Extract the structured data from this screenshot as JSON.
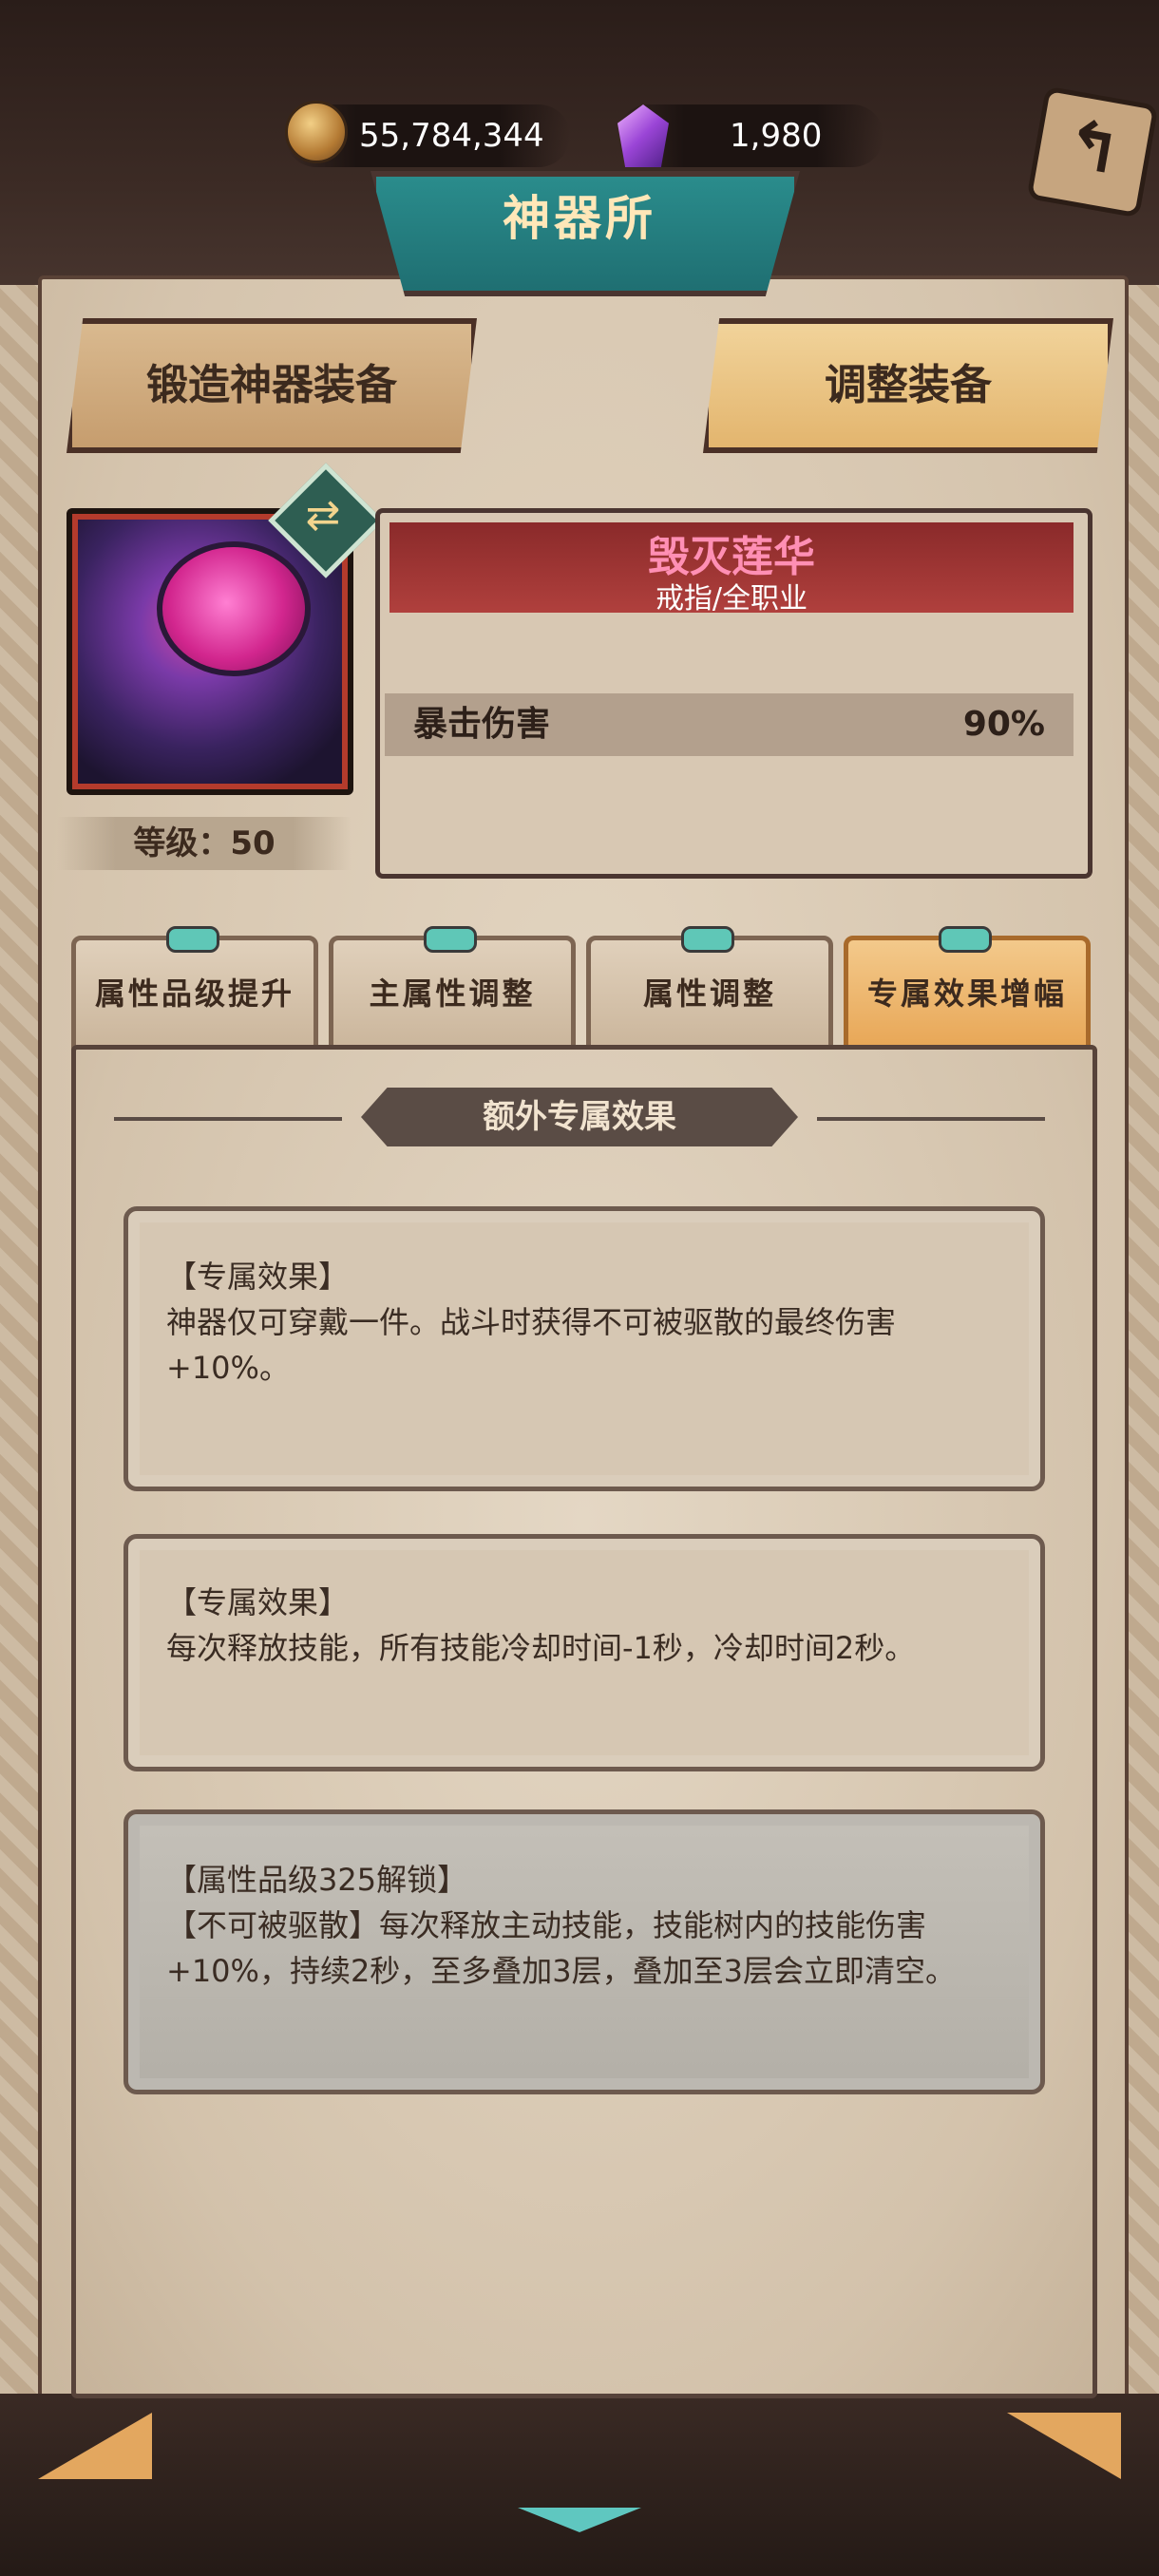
{
  "header": {
    "gold": "55,784,344",
    "gems": "1,980",
    "title": "神器所"
  },
  "top_tabs": [
    {
      "label": "锻造神器装备",
      "active": false
    },
    {
      "label": "调整装备",
      "active": true
    }
  ],
  "item": {
    "name": "毁灭莲华",
    "type": "戒指/全职业",
    "level_label": "等级：50",
    "stat": {
      "name": "暴击伤害",
      "value": "90%"
    }
  },
  "sub_tabs": [
    {
      "label": "属性品级提升",
      "active": false
    },
    {
      "label": "主属性调整",
      "active": false
    },
    {
      "label": "属性调整",
      "active": false
    },
    {
      "label": "专属效果增幅",
      "active": true
    }
  ],
  "section_title": "额外专属效果",
  "effects": [
    {
      "title": "【专属效果】",
      "body1": "神器仅可穿戴一件。战斗时获得不可被驱散的最终伤害",
      "body2": "+10%。",
      "locked": false
    },
    {
      "title": "【专属效果】",
      "body1": "每次释放技能，所有技能冷却时间-1秒，冷却时间2秒。",
      "body2": "",
      "locked": false
    },
    {
      "title": "【属性品级325解锁】",
      "body1": "【不可被驱散】每次释放主动技能，技能树内的技能伤害",
      "body2": "+10%，持续2秒，至多叠加3层，叠加至3层会立即清空。",
      "locked": true
    }
  ],
  "colors": {
    "accent": "#e8a757",
    "teal": "#2a8c8c",
    "item_name": "#ff8fb4"
  }
}
